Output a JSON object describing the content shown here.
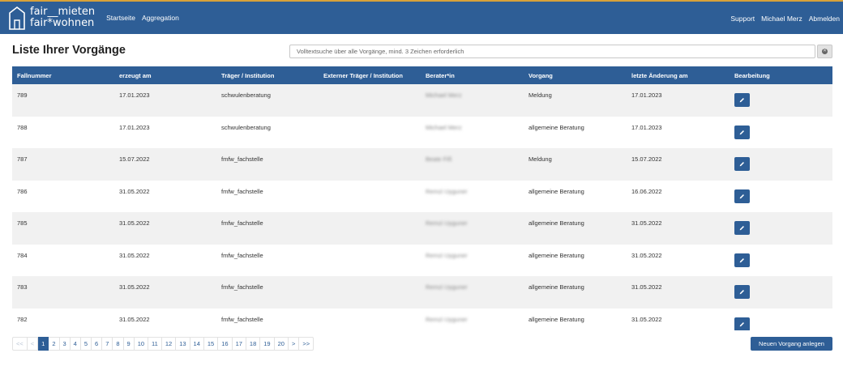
{
  "app": {
    "logo_line1": "fair__mieten",
    "logo_line2": "fair*wohnen",
    "brand_color": "#2e5e96",
    "accent_color": "#d8a23a"
  },
  "nav": {
    "left": [
      "Startseite",
      "Aggregation"
    ],
    "right": [
      "Support",
      "Michael Merz",
      "Abmelden"
    ]
  },
  "page": {
    "title": "Liste Ihrer Vorgänge",
    "search_placeholder": "Volltextsuche über alle Vorgänge, mind. 3 Zeichen erforderlich",
    "clear_icon": "close-circle-icon"
  },
  "table": {
    "columns": [
      "Fallnummer",
      "erzeugt am",
      "Träger / Institution",
      "Externer Träger / Institution",
      "Berater*in",
      "Vorgang",
      "letzte Änderung am",
      "Bearbeitung"
    ],
    "rows": [
      {
        "id": "789",
        "created": "17.01.2023",
        "org": "schwulenberatung",
        "ext_org": "",
        "advisor": "Michael Merz",
        "process": "Meldung",
        "changed": "17.01.2023"
      },
      {
        "id": "788",
        "created": "17.01.2023",
        "org": "schwulenberatung",
        "ext_org": "",
        "advisor": "Michael Merz",
        "process": "allgemeine Beratung",
        "changed": "17.01.2023"
      },
      {
        "id": "787",
        "created": "15.07.2022",
        "org": "fmfw_fachstelle",
        "ext_org": "",
        "advisor": "Beate Fiß",
        "process": "Meldung",
        "changed": "15.07.2022"
      },
      {
        "id": "786",
        "created": "31.05.2022",
        "org": "fmfw_fachstelle",
        "ext_org": "",
        "advisor": "Remzi Uyguner",
        "process": "allgemeine Beratung",
        "changed": "16.06.2022"
      },
      {
        "id": "785",
        "created": "31.05.2022",
        "org": "fmfw_fachstelle",
        "ext_org": "",
        "advisor": "Remzi Uyguner",
        "process": "allgemeine Beratung",
        "changed": "31.05.2022"
      },
      {
        "id": "784",
        "created": "31.05.2022",
        "org": "fmfw_fachstelle",
        "ext_org": "",
        "advisor": "Remzi Uyguner",
        "process": "allgemeine Beratung",
        "changed": "31.05.2022"
      },
      {
        "id": "783",
        "created": "31.05.2022",
        "org": "fmfw_fachstelle",
        "ext_org": "",
        "advisor": "Remzi Uyguner",
        "process": "allgemeine Beratung",
        "changed": "31.05.2022"
      },
      {
        "id": "782",
        "created": "31.05.2022",
        "org": "fmfw_fachstelle",
        "ext_org": "",
        "advisor": "Remzi Uyguner",
        "process": "allgemeine Beratung",
        "changed": "31.05.2022"
      }
    ],
    "edit_icon": "pencil-icon"
  },
  "pagination": {
    "first": "<<",
    "prev": "<",
    "pages": [
      "1",
      "2",
      "3",
      "4",
      "5",
      "6",
      "7",
      "8",
      "9",
      "10",
      "11",
      "12",
      "13",
      "14",
      "15",
      "16",
      "17",
      "18",
      "19",
      "20"
    ],
    "active_page": "1",
    "next": ">",
    "last": ">>"
  },
  "actions": {
    "new_label": "Neuen Vorgang anlegen"
  }
}
